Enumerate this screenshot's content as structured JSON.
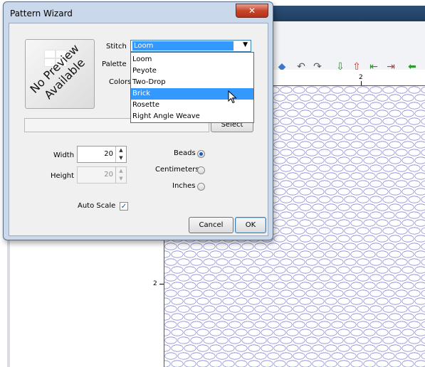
{
  "dialog": {
    "title": "Pattern Wizard",
    "close_glyph": "✕",
    "preview": {
      "line1": "No Preview",
      "line2": "Available"
    },
    "stitch_label": "Stitch",
    "palette_label": "Palette",
    "colors_label": "Colors",
    "stitch_selected": "Loom",
    "stitch_options": [
      "Loom",
      "Peyote",
      "Two-Drop",
      "Brick",
      "Rosette",
      "Right Angle Weave"
    ],
    "stitch_highlighted": "Brick",
    "select_label": "Select",
    "width_label": "Width",
    "width_value": "20",
    "height_label": "Height",
    "height_value": "20",
    "units": [
      {
        "label": "Beads",
        "selected": true
      },
      {
        "label": "Centimeters",
        "selected": false
      },
      {
        "label": "Inches",
        "selected": false
      }
    ],
    "autoscale_label": "Auto Scale",
    "autoscale_checked": true,
    "cancel_label": "Cancel",
    "ok_label": "OK"
  },
  "app": {
    "ruler_top_label": "2",
    "ruler_left_label": "2",
    "toolbar_icons": [
      "diamond-icon",
      "undo-icon",
      "redo-icon",
      "import-icon",
      "export-icon",
      "shift-left-icon",
      "shift-right-icon",
      "arrow-left-icon"
    ],
    "bead_color": "#8c8cd8"
  }
}
